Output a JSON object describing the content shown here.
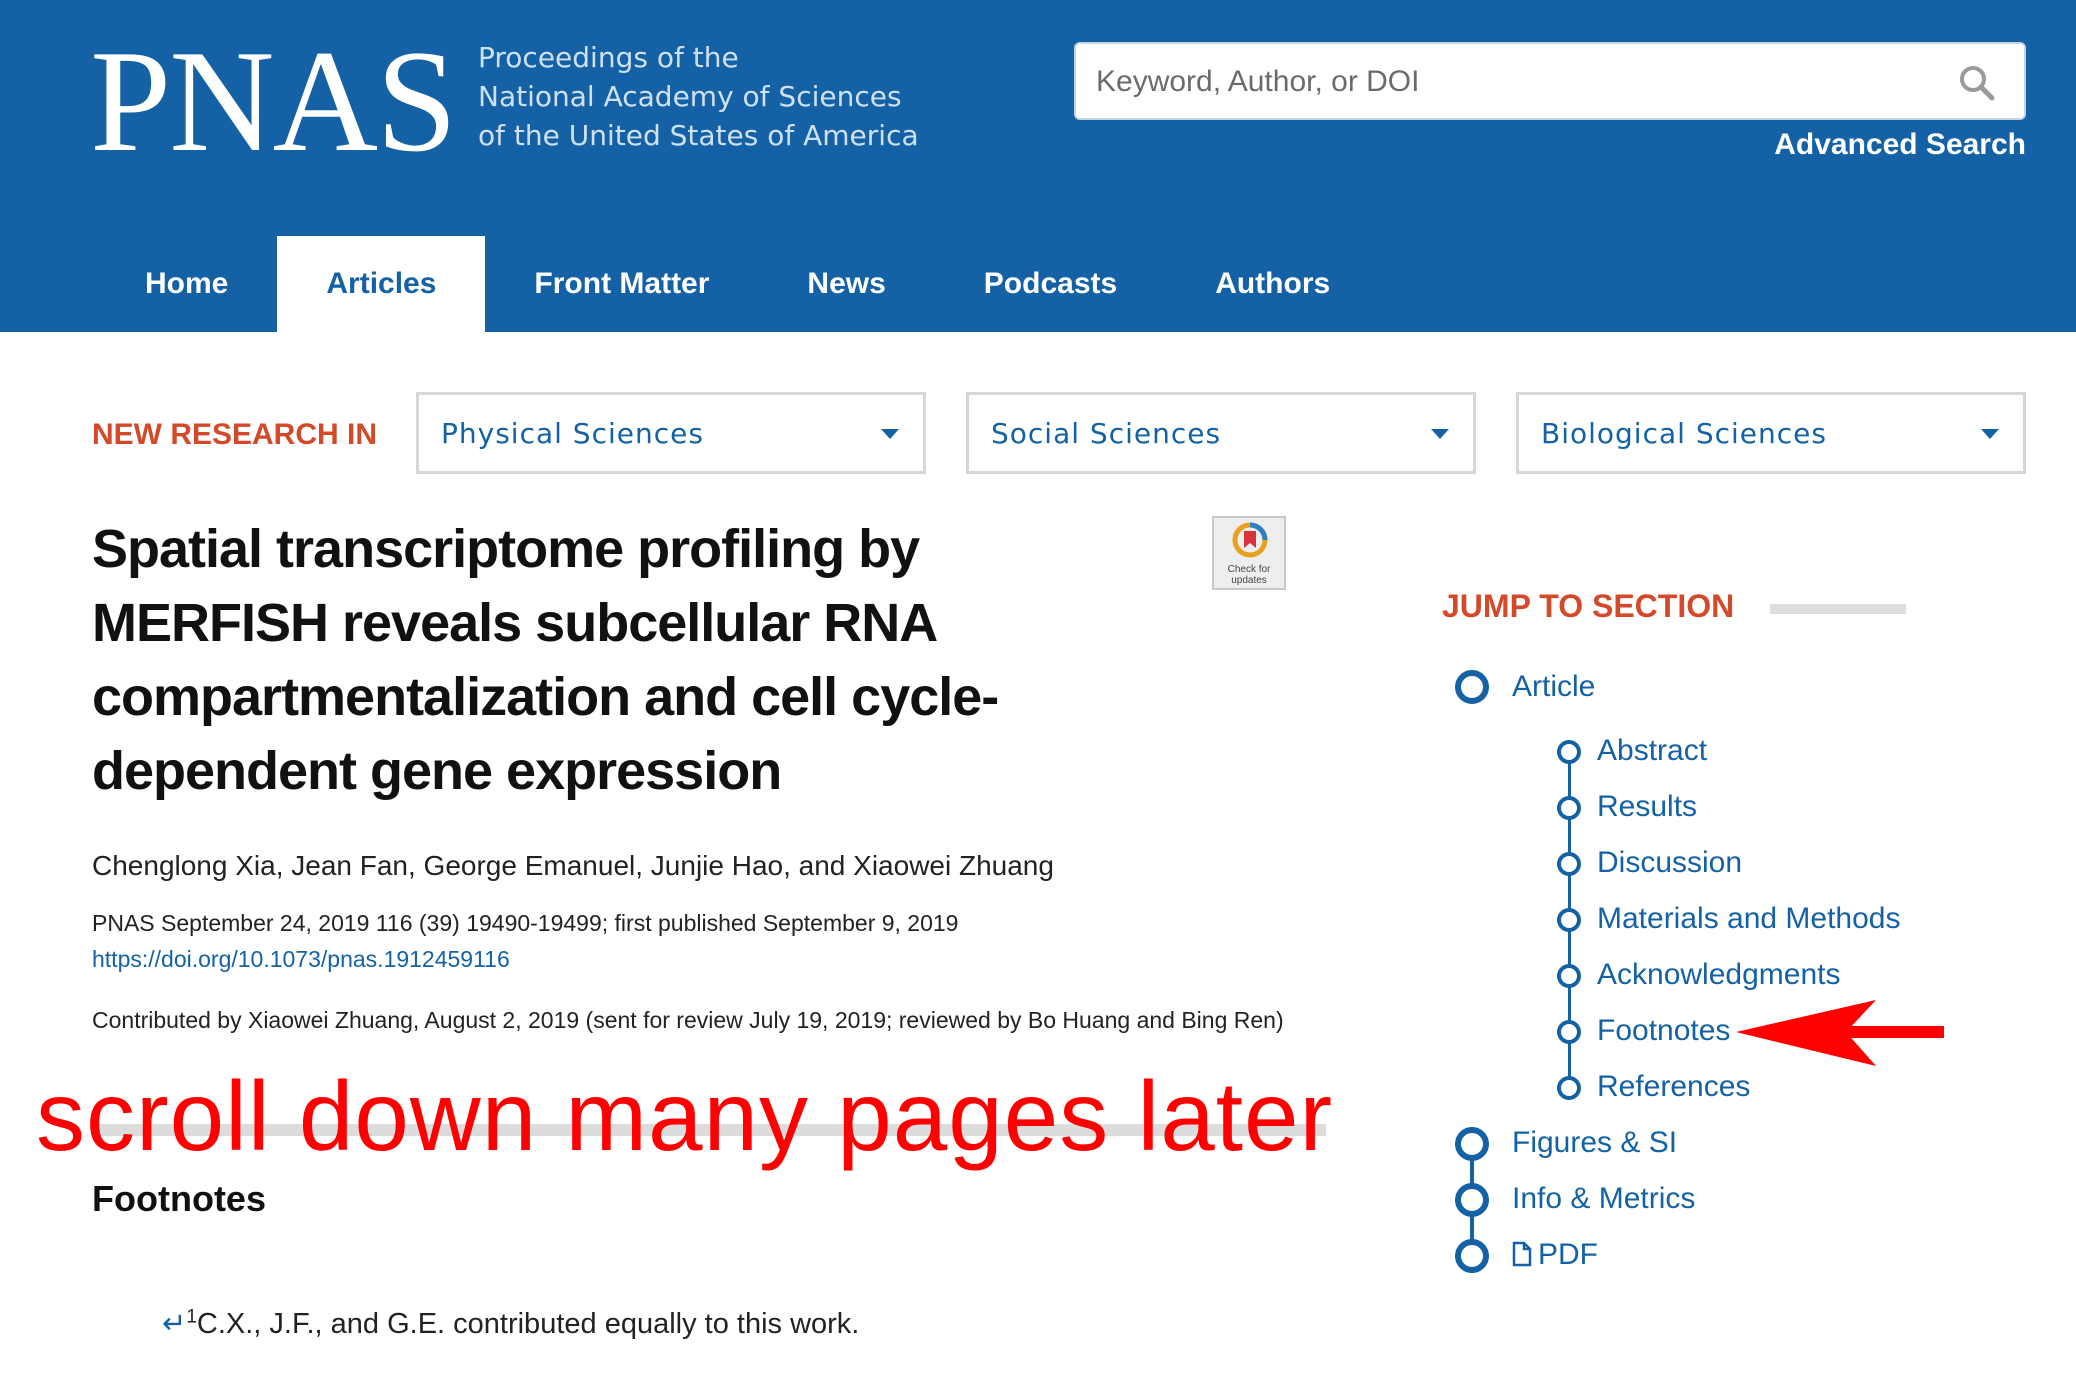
{
  "header": {
    "logo": "PNAS",
    "tagline": [
      "Proceedings of the",
      "National Academy of Sciences",
      "of the United States of America"
    ],
    "search_placeholder": "Keyword, Author, or DOI",
    "advanced_search": "Advanced Search",
    "nav": [
      {
        "label": "Home",
        "active": false
      },
      {
        "label": "Articles",
        "active": true
      },
      {
        "label": "Front Matter",
        "active": false
      },
      {
        "label": "News",
        "active": false
      },
      {
        "label": "Podcasts",
        "active": false
      },
      {
        "label": "Authors",
        "active": false
      }
    ]
  },
  "new_research": {
    "label": "NEW RESEARCH IN",
    "selects": [
      "Physical Sciences",
      "Social Sciences",
      "Biological Sciences"
    ]
  },
  "article": {
    "title": "Spatial transcriptome profiling by MERFISH reveals subcellular RNA compartmentalization and cell cycle-dependent gene expression",
    "crossmark_text": "Check for updates",
    "authors": "Chenglong Xia, Jean Fan, George Emanuel, Junjie Hao, and Xiaowei Zhuang",
    "citation": "PNAS September 24, 2019 116 (39) 19490-19499; first published September 9, 2019",
    "doi": "https://doi.org/10.1073/pnas.1912459116",
    "contributed": "Contributed by Xiaowei Zhuang, August 2, 2019 (sent for review July 19, 2019; reviewed by Bo Huang and Bing Ren)"
  },
  "annotation": "scroll down many pages later",
  "footnotes": {
    "heading": "Footnotes",
    "items": [
      {
        "marker": "1",
        "text": "C.X., J.F., and G.E. contributed equally to this work."
      }
    ]
  },
  "jump_to_section": {
    "label": "JUMP TO SECTION",
    "article": "Article",
    "subsections": [
      "Abstract",
      "Results",
      "Discussion",
      "Materials and Methods",
      "Acknowledgments",
      "Footnotes",
      "References"
    ],
    "after": [
      "Figures & SI",
      "Info & Metrics",
      "PDF"
    ]
  },
  "colors": {
    "brand_blue": "#1462a5",
    "accent_orange": "#d3492a",
    "annotation_red": "#ff0000"
  }
}
